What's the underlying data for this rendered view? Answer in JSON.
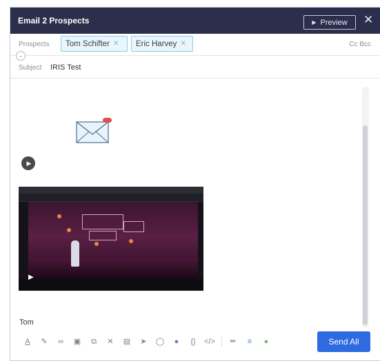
{
  "header": {
    "title": "Email 2 Prospects",
    "preview_label": "Preview",
    "close_icon": "close-icon"
  },
  "prospects": {
    "label": "Prospects",
    "chips": [
      "Tom Schifter",
      "Eric Harvey"
    ],
    "cc_bcc": "Cc  Bcc"
  },
  "subject": {
    "label": "Subject",
    "value": "IRIS Test"
  },
  "body": {
    "signature": "Tom",
    "envelope_icon": "envelope-icon",
    "play_icon": "play-circle-icon",
    "video_thumbnail": "video-thumbnail"
  },
  "toolbar": {
    "icons": [
      "text-color-icon",
      "attachment-icon",
      "link-icon",
      "template-icon",
      "copy-icon",
      "clear-format-icon",
      "calendar-icon",
      "send-icon",
      "meeting-icon",
      "video-icon",
      "variable-icon",
      "code-icon",
      "signature-icon",
      "snippet-icon",
      "ai-icon"
    ],
    "send_label": "Send All",
    "accent": "#2f6be0"
  },
  "colors": {
    "header_bg": "#2b2f4b",
    "chip_border": "#8ecbe6",
    "chip_bg": "#eaf6fc"
  }
}
